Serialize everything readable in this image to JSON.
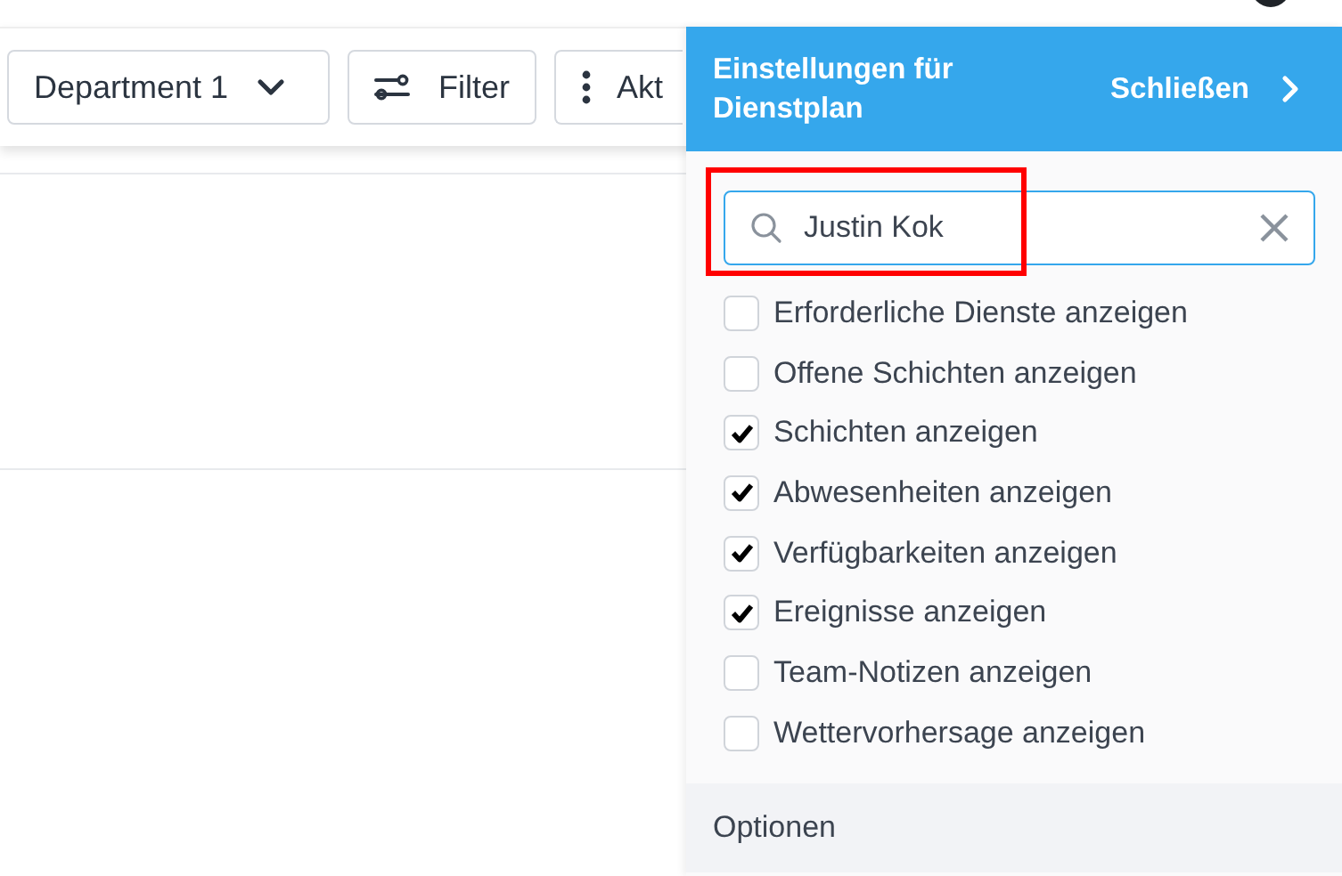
{
  "toolbar": {
    "buttons": [
      {
        "kind": "dropdown",
        "label": "Department 1"
      },
      {
        "kind": "filter",
        "label": "Filter"
      },
      {
        "kind": "more",
        "label": "Akt"
      }
    ]
  },
  "panel": {
    "title": "Einstellungen für Dienstplan",
    "close_label": "Schließen",
    "search": {
      "value": "Justin Kok",
      "highlighted": true
    },
    "options": [
      {
        "label": "Erforderliche Dienste anzeigen",
        "checked": false
      },
      {
        "label": "Offene Schichten anzeigen",
        "checked": false
      },
      {
        "label": "Schichten anzeigen",
        "checked": true
      },
      {
        "label": "Abwesenheiten anzeigen",
        "checked": true
      },
      {
        "label": "Verfügbarkeiten anzeigen",
        "checked": true
      },
      {
        "label": "Ereignisse anzeigen",
        "checked": true
      },
      {
        "label": "Team-Notizen anzeigen",
        "checked": false
      },
      {
        "label": "Wettervorhersage anzeigen",
        "checked": false
      }
    ],
    "section": "Optionen"
  }
}
